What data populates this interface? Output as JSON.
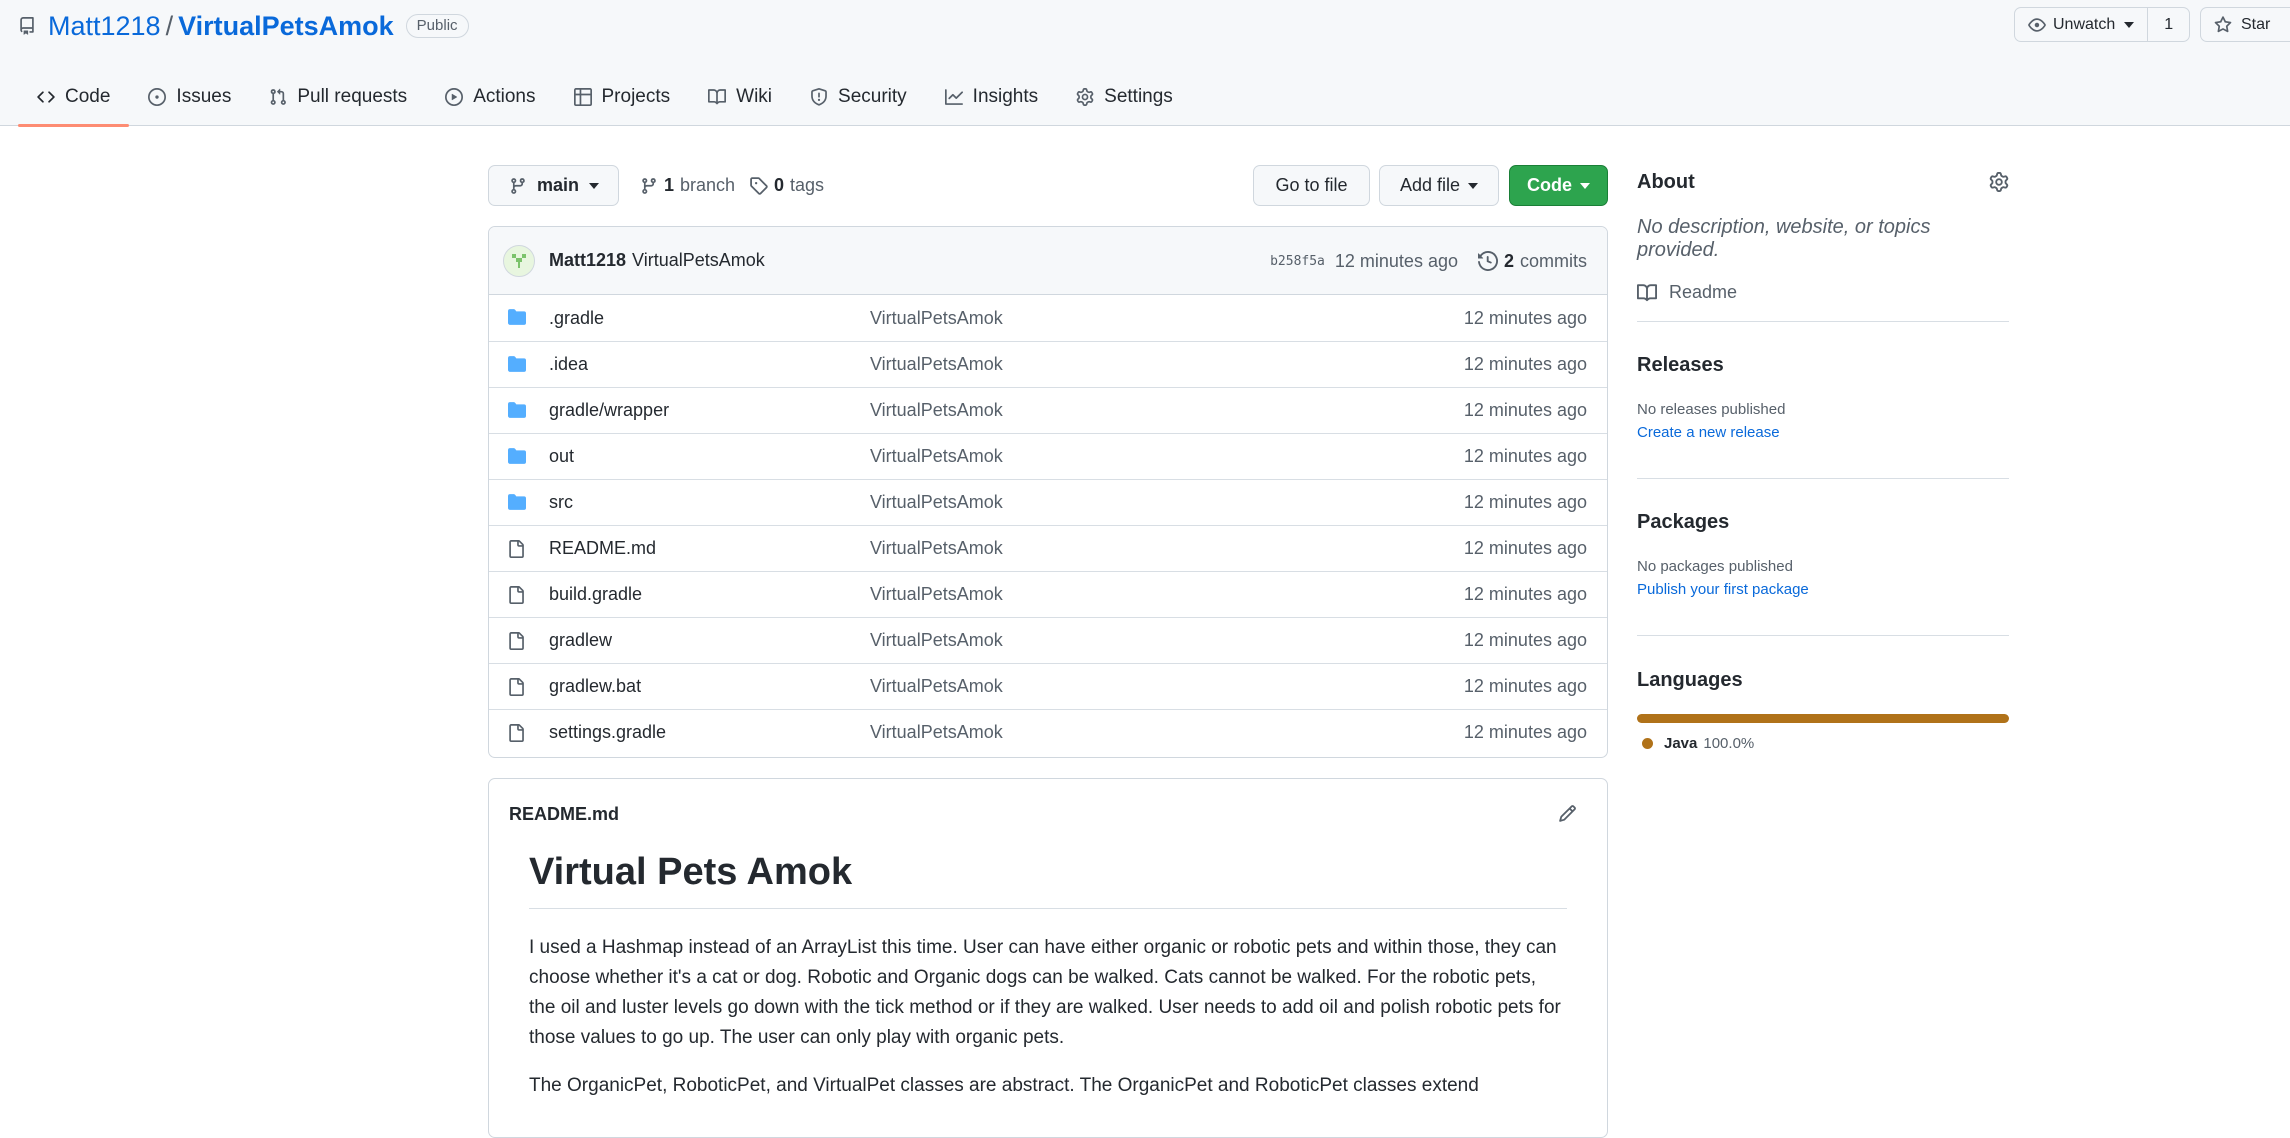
{
  "repo": {
    "owner": "Matt1218",
    "separator": "/",
    "name": "VirtualPetsAmok",
    "visibility": "Public"
  },
  "actions": {
    "watch_label": "Unwatch",
    "watch_count": "1",
    "star_label": "Star"
  },
  "tabs": [
    {
      "label": "Code",
      "icon": "code-icon",
      "selected": true
    },
    {
      "label": "Issues",
      "icon": "issue-opened-icon"
    },
    {
      "label": "Pull requests",
      "icon": "git-pull-request-icon"
    },
    {
      "label": "Actions",
      "icon": "play-icon"
    },
    {
      "label": "Projects",
      "icon": "table-icon"
    },
    {
      "label": "Wiki",
      "icon": "book-icon"
    },
    {
      "label": "Security",
      "icon": "shield-icon"
    },
    {
      "label": "Insights",
      "icon": "graph-icon"
    },
    {
      "label": "Settings",
      "icon": "gear-icon"
    }
  ],
  "nav": {
    "branch": "main",
    "branch_count": "1",
    "branch_label": "branch",
    "tag_count": "0",
    "tag_label": "tags",
    "go_to_file": "Go to file",
    "add_file": "Add file",
    "code": "Code"
  },
  "commit": {
    "author": "Matt1218",
    "message": "VirtualPetsAmok",
    "sha": "b258f5a",
    "age": "12 minutes ago",
    "count": "2",
    "count_label": "commits"
  },
  "files": [
    {
      "name": ".gradle",
      "type": "folder",
      "message": "VirtualPetsAmok",
      "age": "12 minutes ago"
    },
    {
      "name": ".idea",
      "type": "folder",
      "message": "VirtualPetsAmok",
      "age": "12 minutes ago"
    },
    {
      "name": "gradle/wrapper",
      "type": "folder",
      "message": "VirtualPetsAmok",
      "age": "12 minutes ago"
    },
    {
      "name": "out",
      "type": "folder",
      "message": "VirtualPetsAmok",
      "age": "12 minutes ago"
    },
    {
      "name": "src",
      "type": "folder",
      "message": "VirtualPetsAmok",
      "age": "12 minutes ago"
    },
    {
      "name": "README.md",
      "type": "file",
      "message": "VirtualPetsAmok",
      "age": "12 minutes ago"
    },
    {
      "name": "build.gradle",
      "type": "file",
      "message": "VirtualPetsAmok",
      "age": "12 minutes ago"
    },
    {
      "name": "gradlew",
      "type": "file",
      "message": "VirtualPetsAmok",
      "age": "12 minutes ago"
    },
    {
      "name": "gradlew.bat",
      "type": "file",
      "message": "VirtualPetsAmok",
      "age": "12 minutes ago"
    },
    {
      "name": "settings.gradle",
      "type": "file",
      "message": "VirtualPetsAmok",
      "age": "12 minutes ago"
    }
  ],
  "readme": {
    "filename": "README.md",
    "heading": "Virtual Pets Amok",
    "paragraphs": [
      "I used a Hashmap instead of an ArrayList this time. User can have either organic or robotic pets and within those, they can choose whether it's a cat or dog. Robotic and Organic dogs can be walked. Cats cannot be walked. For the robotic pets, the oil and luster levels go down with the tick method or if they are walked. User needs to add oil and polish robotic pets for those values to go up. The user can only play with organic pets.",
      "The OrganicPet, RoboticPet, and VirtualPet classes are abstract. The OrganicPet and RoboticPet classes extend"
    ]
  },
  "sidebar": {
    "about_title": "About",
    "about_desc": "No description, website, or topics provided.",
    "readme_link": "Readme",
    "releases_title": "Releases",
    "releases_none": "No releases published",
    "releases_create": "Create a new release",
    "packages_title": "Packages",
    "packages_none": "No packages published",
    "packages_publish": "Publish your first package",
    "languages_title": "Languages",
    "languages": [
      {
        "name": "Java",
        "percent": "100.0%",
        "color": "#b07219"
      }
    ]
  },
  "colors": {
    "link": "#0969da",
    "primary_button": "#2da44e",
    "selected_tab_underline": "#fd8c73",
    "folder": "#54aeff"
  }
}
